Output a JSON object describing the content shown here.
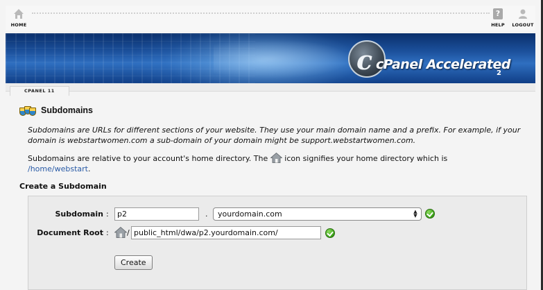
{
  "topnav": {
    "home_label": "HOME",
    "help_label": "HELP",
    "logout_label": "LOGOUT",
    "icons": {
      "home": "home-icon",
      "help": "help-icon",
      "logout": "logout-icon"
    }
  },
  "banner": {
    "logo_letter": "c",
    "brand": "cPanel Accelerated",
    "brand_version": "2"
  },
  "breadcrumb": {
    "label": "CPANEL 11"
  },
  "page": {
    "title": "Subdomains",
    "description": "Subdomains are URLs for different sections of your website. They use your main domain name and a prefix. For example, if your domain is webstartwomen.com a sub-domain of your domain might be support.webstartwomen.com.",
    "home_note_before": "Subdomains are relative to your account's home directory. The",
    "home_note_after": "icon signifies your home directory which is",
    "home_dir": "/home/webstart",
    "home_dir_suffix": "."
  },
  "form": {
    "section_title": "Create a Subdomain",
    "subdomain_label": "Subdomain",
    "subdomain_value": "p2",
    "dot": ".",
    "domain_selected": "yourdomain.com",
    "docroot_label": "Document Root",
    "docroot_slash": "/",
    "docroot_value": "public_html/dwa/p2.yourdomain.com/",
    "colon": ":",
    "create_button": "Create"
  },
  "colors": {
    "accent_link": "#2a5ba6",
    "valid_check": "#3aa018"
  }
}
